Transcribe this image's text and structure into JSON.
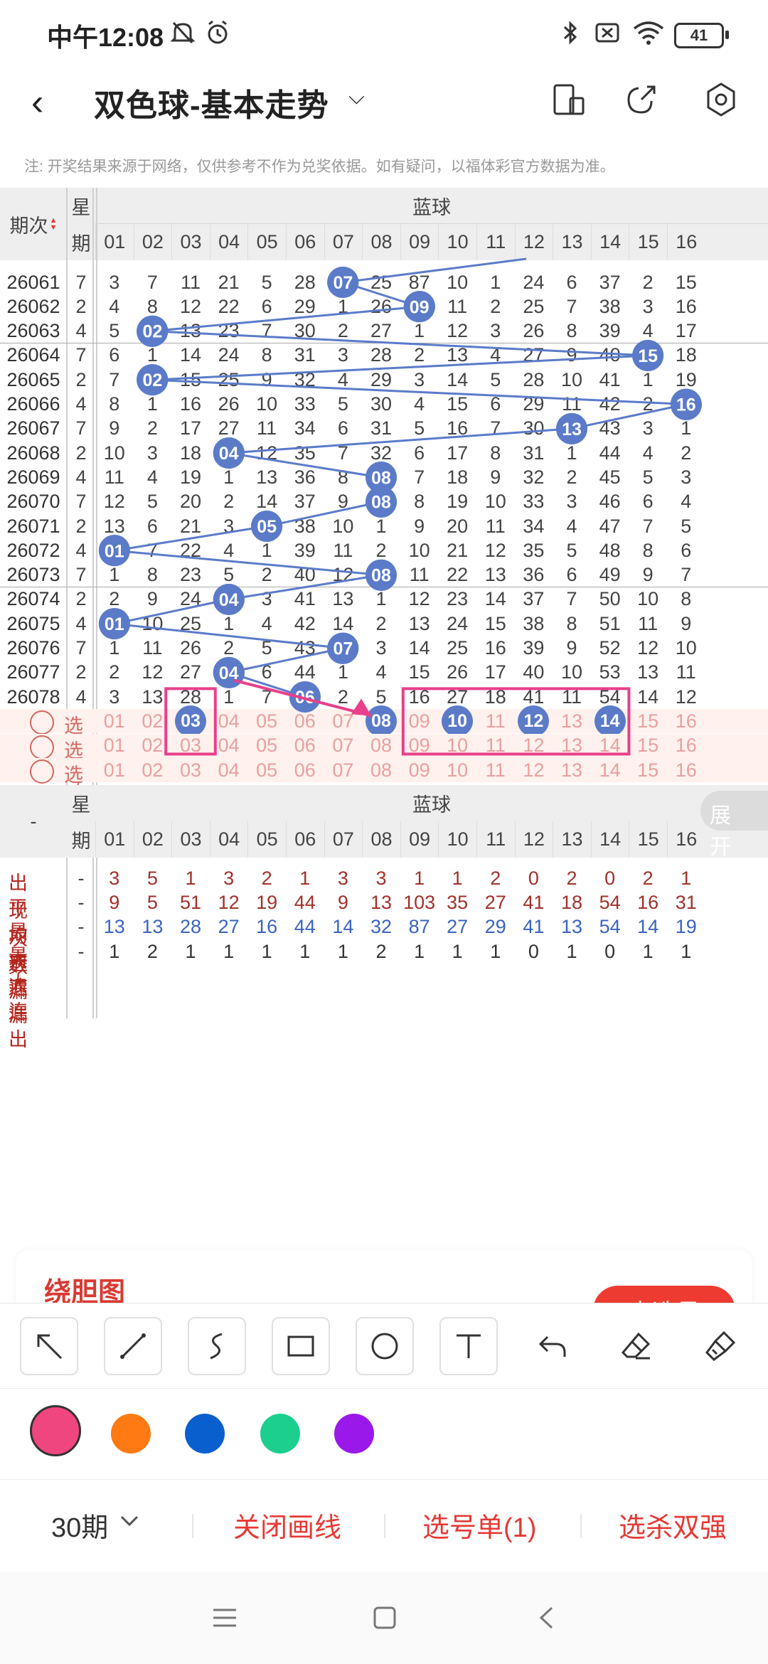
{
  "status_bar": {
    "time": "中午12:08",
    "battery": "41"
  },
  "header": {
    "back_glyph": "‹",
    "title": "双色球-基本走势",
    "chevron": "⌵"
  },
  "notice": "注: 开奖结果来源于网络，仅供参考不作为兑奖依据。如有疑问，以福体彩官方数据为准。",
  "table": {
    "col_issue": "期次",
    "col_week_top": "星",
    "col_week_bottom": "期",
    "blue_label": "蓝球",
    "blue_cols": [
      "01",
      "02",
      "03",
      "04",
      "05",
      "06",
      "07",
      "08",
      "09",
      "10",
      "11",
      "12",
      "13",
      "14",
      "15",
      "16"
    ],
    "rows": [
      {
        "issue": "26061",
        "week": "7",
        "cells": [
          "3",
          "7",
          "11",
          "21",
          "5",
          "28",
          "07",
          "25",
          "87",
          "10",
          "1",
          "24",
          "6",
          "37",
          "2",
          "15"
        ],
        "ball": 7
      },
      {
        "issue": "26062",
        "week": "2",
        "cells": [
          "4",
          "8",
          "12",
          "22",
          "6",
          "29",
          "1",
          "26",
          "09",
          "11",
          "2",
          "25",
          "7",
          "38",
          "3",
          "16"
        ],
        "ball": 9
      },
      {
        "issue": "26063",
        "week": "4",
        "cells": [
          "5",
          "02",
          "13",
          "23",
          "7",
          "30",
          "2",
          "27",
          "1",
          "12",
          "3",
          "26",
          "8",
          "39",
          "4",
          "17"
        ],
        "ball": 2
      },
      {
        "issue": "26064",
        "week": "7",
        "cells": [
          "6",
          "1",
          "14",
          "24",
          "8",
          "31",
          "3",
          "28",
          "2",
          "13",
          "4",
          "27",
          "9",
          "40",
          "15",
          "18"
        ],
        "ball": 15
      },
      {
        "issue": "26065",
        "week": "2",
        "cells": [
          "7",
          "02",
          "15",
          "25",
          "9",
          "32",
          "4",
          "29",
          "3",
          "14",
          "5",
          "28",
          "10",
          "41",
          "1",
          "19"
        ],
        "ball": 2
      },
      {
        "issue": "26066",
        "week": "4",
        "cells": [
          "8",
          "1",
          "16",
          "26",
          "10",
          "33",
          "5",
          "30",
          "4",
          "15",
          "6",
          "29",
          "11",
          "42",
          "2",
          "16"
        ],
        "ball": 16
      },
      {
        "issue": "26067",
        "week": "7",
        "cells": [
          "9",
          "2",
          "17",
          "27",
          "11",
          "34",
          "6",
          "31",
          "5",
          "16",
          "7",
          "30",
          "13",
          "43",
          "3",
          "1"
        ],
        "ball": 13
      },
      {
        "issue": "26068",
        "week": "2",
        "cells": [
          "10",
          "3",
          "18",
          "04",
          "12",
          "35",
          "7",
          "32",
          "6",
          "17",
          "8",
          "31",
          "1",
          "44",
          "4",
          "2"
        ],
        "ball": 4
      },
      {
        "issue": "26069",
        "week": "4",
        "cells": [
          "11",
          "4",
          "19",
          "1",
          "13",
          "36",
          "8",
          "08",
          "7",
          "18",
          "9",
          "32",
          "2",
          "45",
          "5",
          "3"
        ],
        "ball": 8
      },
      {
        "issue": "26070",
        "week": "7",
        "cells": [
          "12",
          "5",
          "20",
          "2",
          "14",
          "37",
          "9",
          "08",
          "8",
          "19",
          "10",
          "33",
          "3",
          "46",
          "6",
          "4"
        ],
        "ball": 8
      },
      {
        "issue": "26071",
        "week": "2",
        "cells": [
          "13",
          "6",
          "21",
          "3",
          "05",
          "38",
          "10",
          "1",
          "9",
          "20",
          "11",
          "34",
          "4",
          "47",
          "7",
          "5"
        ],
        "ball": 5
      },
      {
        "issue": "26072",
        "week": "4",
        "cells": [
          "01",
          "7",
          "22",
          "4",
          "1",
          "39",
          "11",
          "2",
          "10",
          "21",
          "12",
          "35",
          "5",
          "48",
          "8",
          "6"
        ],
        "ball": 1
      },
      {
        "issue": "26073",
        "week": "7",
        "cells": [
          "1",
          "8",
          "23",
          "5",
          "2",
          "40",
          "12",
          "08",
          "11",
          "22",
          "13",
          "36",
          "6",
          "49",
          "9",
          "7"
        ],
        "ball": 8
      },
      {
        "issue": "26074",
        "week": "2",
        "cells": [
          "2",
          "9",
          "24",
          "04",
          "3",
          "41",
          "13",
          "1",
          "12",
          "23",
          "14",
          "37",
          "7",
          "50",
          "10",
          "8"
        ],
        "ball": 4
      },
      {
        "issue": "26075",
        "week": "4",
        "cells": [
          "01",
          "10",
          "25",
          "1",
          "4",
          "42",
          "14",
          "2",
          "13",
          "24",
          "15",
          "38",
          "8",
          "51",
          "11",
          "9"
        ],
        "ball": 1
      },
      {
        "issue": "26076",
        "week": "7",
        "cells": [
          "1",
          "11",
          "26",
          "2",
          "5",
          "43",
          "07",
          "3",
          "14",
          "25",
          "16",
          "39",
          "9",
          "52",
          "12",
          "10"
        ],
        "ball": 7
      },
      {
        "issue": "26077",
        "week": "2",
        "cells": [
          "2",
          "12",
          "27",
          "04",
          "6",
          "44",
          "1",
          "4",
          "15",
          "26",
          "17",
          "40",
          "10",
          "53",
          "13",
          "11"
        ],
        "ball": 4
      },
      {
        "issue": "26078",
        "week": "4",
        "cells": [
          "3",
          "13",
          "28",
          "1",
          "7",
          "06",
          "2",
          "5",
          "16",
          "27",
          "18",
          "41",
          "11",
          "54",
          "14",
          "12"
        ],
        "ball": 6
      }
    ],
    "select_label": "选号",
    "select_rows": [
      {
        "selected": [
          3,
          8,
          10,
          12,
          14
        ]
      },
      {
        "selected": []
      },
      {
        "selected": []
      }
    ],
    "stats_dash": "-",
    "stats": [
      {
        "label": "出现次数",
        "week": "-",
        "values": [
          "3",
          "5",
          "1",
          "3",
          "2",
          "1",
          "3",
          "3",
          "1",
          "1",
          "2",
          "0",
          "2",
          "0",
          "2",
          "1"
        ],
        "color": "red"
      },
      {
        "label": "平均遗漏",
        "week": "-",
        "values": [
          "9",
          "5",
          "51",
          "12",
          "19",
          "44",
          "9",
          "13",
          "103",
          "35",
          "27",
          "41",
          "18",
          "54",
          "16",
          "31"
        ],
        "color": "red"
      },
      {
        "label": "最大遗漏",
        "week": "-",
        "values": [
          "13",
          "13",
          "28",
          "27",
          "16",
          "44",
          "14",
          "32",
          "87",
          "27",
          "29",
          "41",
          "13",
          "54",
          "14",
          "19"
        ],
        "color": "blue"
      },
      {
        "label": "最大连出",
        "week": "-",
        "values": [
          "1",
          "2",
          "1",
          "1",
          "1",
          "1",
          "1",
          "2",
          "1",
          "1",
          "1",
          "0",
          "1",
          "0",
          "1",
          "1"
        ],
        "color": "black"
      }
    ],
    "expand_label": "展开"
  },
  "card_title": "绕胆图",
  "card_button": "去选号",
  "colors": [
    "#f0467f",
    "#ff7a12",
    "#0a5fcf",
    "#1ccf8f",
    "#9a19ea"
  ],
  "bottom": {
    "period": "30期",
    "close_draw": "关闭画线",
    "pick_list": "选号单(1)",
    "kill": "选杀双强"
  },
  "accent": "#e53935",
  "ball_color": "#5b7bc9"
}
